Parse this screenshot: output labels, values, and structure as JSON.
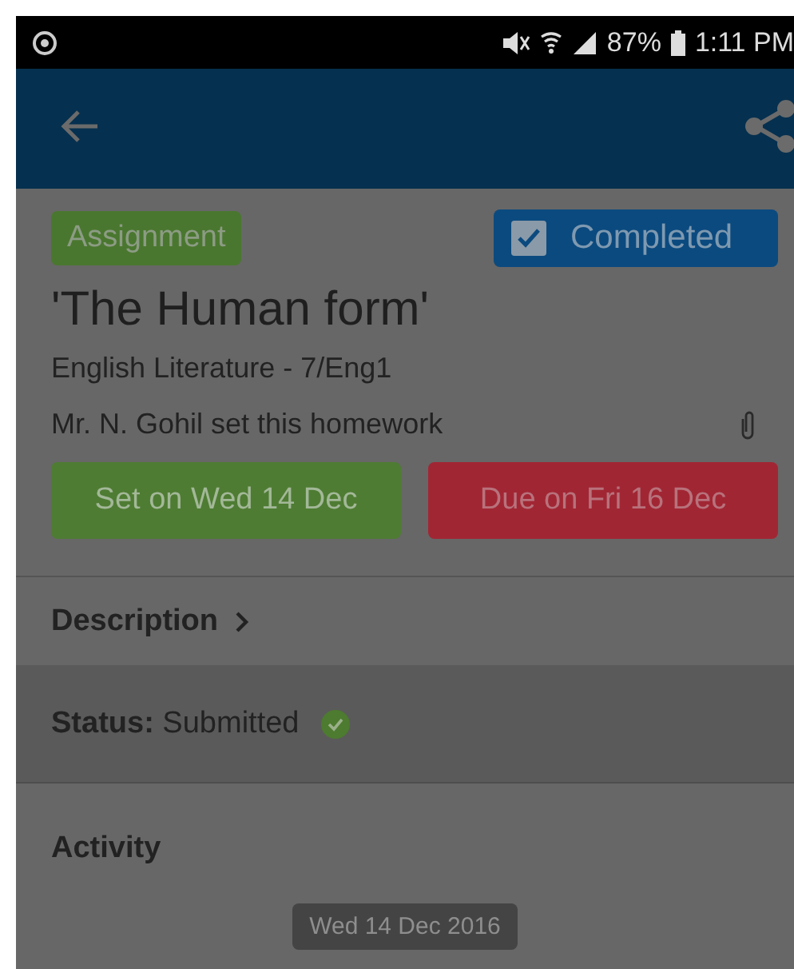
{
  "status_bar": {
    "battery": "87%",
    "time": "1:11 PM"
  },
  "assignment": {
    "type_badge": "Assignment",
    "completed": {
      "label": "Completed",
      "checked": true
    },
    "title": "'The Human form'",
    "subject": "English Literature - 7/Eng1",
    "teacher": "Mr. N. Gohil set this homework",
    "set_date": "Set on Wed 14 Dec",
    "due_date": "Due on Fri 16 Dec"
  },
  "description": {
    "label": "Description"
  },
  "status": {
    "label": "Status:",
    "value": "Submitted"
  },
  "activity": {
    "heading": "Activity",
    "date_chip": "Wed 14 Dec 2016"
  }
}
